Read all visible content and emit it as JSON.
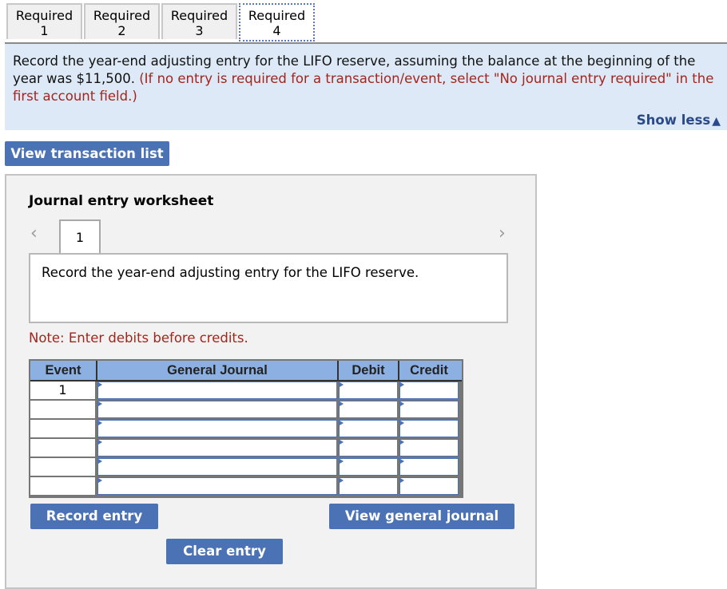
{
  "tabs": [
    {
      "label": "Required",
      "number": "1",
      "active": false
    },
    {
      "label": "Required",
      "number": "2",
      "active": false
    },
    {
      "label": "Required",
      "number": "3",
      "active": false
    },
    {
      "label": "Required",
      "number": "4",
      "active": true
    }
  ],
  "instructions": {
    "main_text": "Record the year-end adjusting entry for the LIFO reserve, assuming the balance at the beginning of the year was $11,500.",
    "note_text": "(If no entry is required for a transaction/event, select \"No journal entry required\" in the first account field.)",
    "show_less_label": "Show less",
    "show_less_icon": "triangle-up-icon"
  },
  "view_transaction_list_label": "View transaction list",
  "worksheet": {
    "title": "Journal entry worksheet",
    "prev_icon": "chevron-left-icon",
    "next_icon": "chevron-right-icon",
    "current_page": "1",
    "description": "Record the year-end adjusting entry for the LIFO reserve.",
    "note": "Note: Enter debits before credits.",
    "table": {
      "headers": [
        "Event",
        "General Journal",
        "Debit",
        "Credit"
      ],
      "rows": [
        {
          "event": "1",
          "account": "",
          "debit": "",
          "credit": ""
        },
        {
          "event": "",
          "account": "",
          "debit": "",
          "credit": ""
        },
        {
          "event": "",
          "account": "",
          "debit": "",
          "credit": ""
        },
        {
          "event": "",
          "account": "",
          "debit": "",
          "credit": ""
        },
        {
          "event": "",
          "account": "",
          "debit": "",
          "credit": ""
        },
        {
          "event": "",
          "account": "",
          "debit": "",
          "credit": ""
        }
      ]
    },
    "buttons": {
      "record_entry": "Record entry",
      "clear_entry": "Clear entry",
      "view_general_journal": "View general journal"
    }
  }
}
